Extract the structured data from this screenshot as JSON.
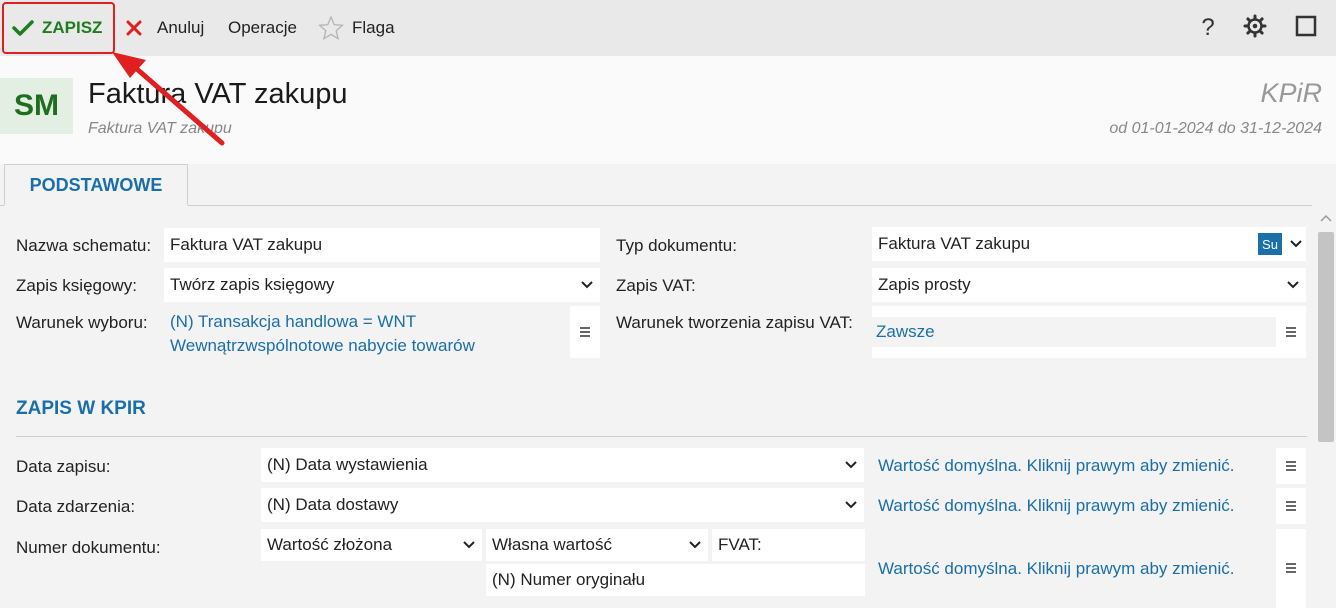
{
  "toolbar": {
    "save_label": "ZAPISZ",
    "cancel_label": "Anuluj",
    "operations_label": "Operacje",
    "flag_label": "Flaga",
    "help_label": "?"
  },
  "header": {
    "avatar": "SM",
    "title": "Faktura VAT zakupu",
    "subtitle": "Faktura VAT zakupu",
    "module": "KPiR",
    "period": "od 01-01-2024 do 31-12-2024"
  },
  "tabs": [
    {
      "label": "PODSTAWOWE"
    }
  ],
  "basic": {
    "scheme_name_label": "Nazwa schematu:",
    "scheme_name_value": "Faktura VAT zakupu",
    "booking_label": "Zapis księgowy:",
    "booking_value": "Twórz zapis księgowy",
    "selection_label": "Warunek wyboru:",
    "selection_line1": "(N) Transakcja handlowa = WNT",
    "selection_line2": "Wewnątrzwspólnotowe nabycie towarów",
    "doc_type_label": "Typ dokumentu:",
    "doc_type_value": "Faktura VAT zakupu",
    "doc_type_badge": "Su",
    "vat_label": "Zapis VAT:",
    "vat_value": "Zapis prosty",
    "vat_condition_label": "Warunek tworzenia zapisu VAT:",
    "vat_condition_value": "Zawsze"
  },
  "kpir": {
    "section_title": "ZAPIS W KPIR",
    "entry_date_label": "Data zapisu:",
    "entry_date_value": "(N) Data wystawienia",
    "entry_date_default": "Wartość domyślna. Kliknij prawym aby zmienić.",
    "event_date_label": "Data zdarzenia:",
    "event_date_value": "(N) Data dostawy",
    "event_date_default": "Wartość domyślna. Kliknij prawym aby zmienić.",
    "doc_number_label": "Numer dokumentu:",
    "doc_number_type": "Wartość złożona",
    "doc_number_own": "Własna wartość",
    "doc_number_prefix": "FVAT:",
    "doc_number_orig": "(N) Numer oryginału",
    "doc_number_default": "Wartość domyślna. Kliknij prawym aby zmienić."
  },
  "colors": {
    "accent": "#1b6fa8",
    "save_green": "#1e7d1e",
    "cancel_red": "#e02020",
    "highlight_red": "#e02020"
  }
}
